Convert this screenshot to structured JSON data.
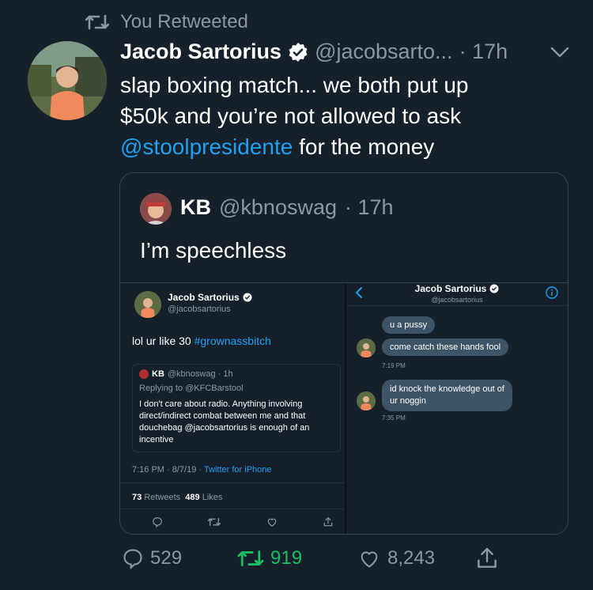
{
  "retweet_context": {
    "label": "You Retweeted"
  },
  "tweet": {
    "name": "Jacob Sartorius",
    "handle": "@jacobsarto...",
    "time": "· 17h",
    "text_part1": "slap boxing match... we both put up",
    "text_part2": "$50k and you’re not allowed to ask",
    "mention": "@stoolpresidente",
    "text_part3": " for the money"
  },
  "quote": {
    "name": "KB",
    "handle": "@kbnoswag",
    "time": "· 17h",
    "text": "I’m speechless"
  },
  "embedded_left": {
    "name": "Jacob Sartorius",
    "handle": "@jacobsartorius",
    "text_plain": "lol ur like 30 ",
    "hashtag": "#grownassbitch",
    "quoted": {
      "name": "KB",
      "handle": "@kbnoswag · 1h",
      "replying": "Replying to @KFCBarstool",
      "line1": "I don't care about radio. Anything involving",
      "line2": "direct/indirect combat between me and that",
      "line3": "douchebag @jacobsartorius is enough of an",
      "line4": "incentive"
    },
    "meta_time": "7:16 PM · 8/7/19 · ",
    "meta_client": "Twitter for iPhone",
    "retweets_count": "73",
    "retweets_label": "Retweets",
    "likes_count": "489",
    "likes_label": "Likes"
  },
  "embedded_right": {
    "title": "Jacob Sartorius",
    "subtitle": "@jacobsartorius",
    "msg1": "u a pussy",
    "msg2": "come catch these hands fool",
    "time1": "7:19 PM",
    "msg3_line1": "id knock the knowledge out of",
    "msg3_line2": "ur noggin",
    "time2": "7:35 PM"
  },
  "actions": {
    "replies": "529",
    "retweets": "919",
    "likes": "8,243"
  },
  "colors": {
    "background": "#15202b",
    "accent": "#1da1f2",
    "retweet_green": "#17bf63",
    "muted": "#8899a6"
  }
}
